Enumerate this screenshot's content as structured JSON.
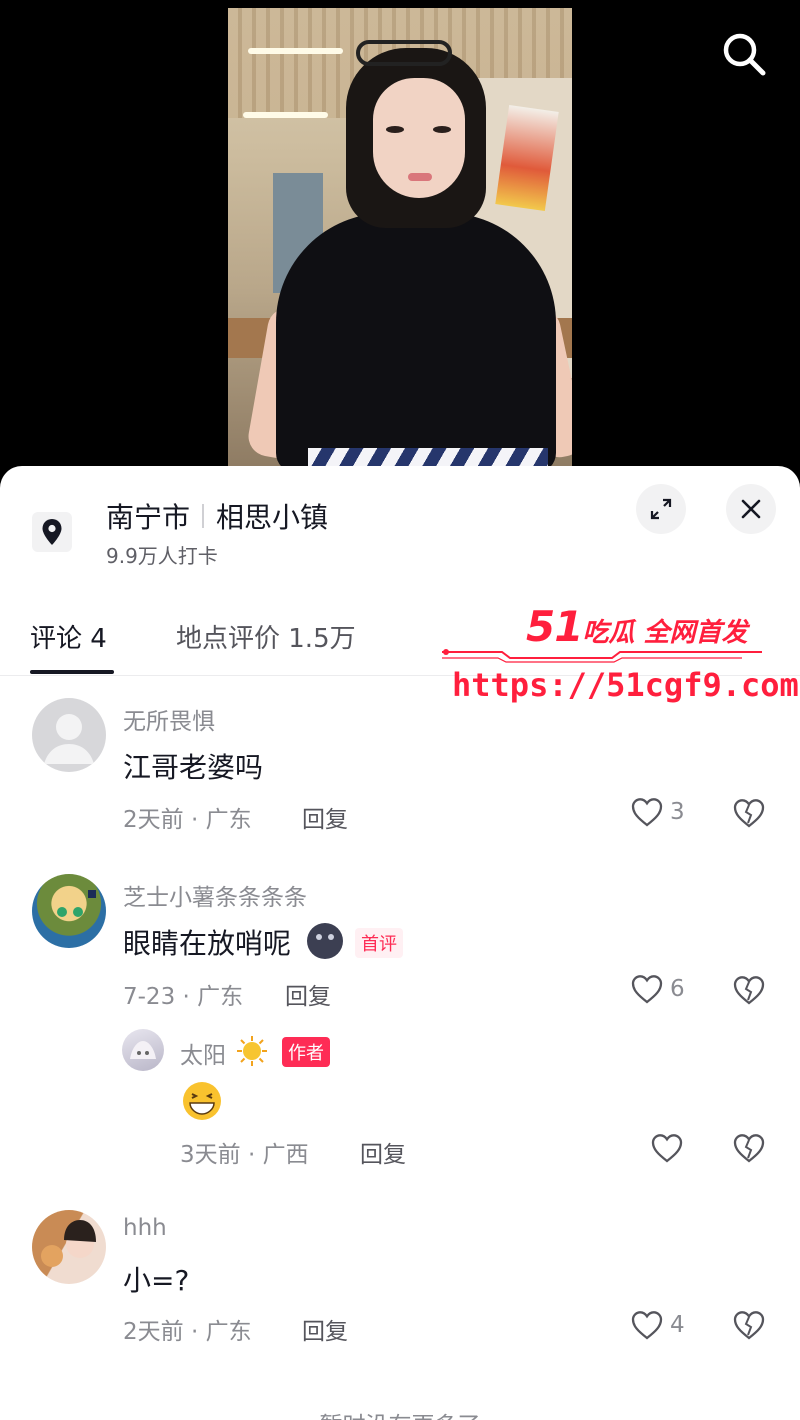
{
  "location": {
    "city": "南宁市",
    "place": "相思小镇",
    "checkins": "9.9万人打卡"
  },
  "tabs": [
    {
      "label": "评论 4",
      "active": true
    },
    {
      "label": "地点评价 1.5万",
      "active": false
    }
  ],
  "watermark": {
    "brand_num": "51",
    "brand_text": "吃瓜 全网首发",
    "url": "https://51cgf9.com"
  },
  "comments": [
    {
      "user": "无所畏惧",
      "text": "江哥老婆吗",
      "meta": "2天前 · 广东",
      "reply": "回复",
      "likes": "3"
    },
    {
      "user": "芝士小薯条条条条",
      "text": "眼睛在放哨呢",
      "badge": "首评",
      "meta": "7-23 · 广东",
      "reply": "回复",
      "likes": "6",
      "sub_reply": {
        "user": "太阳",
        "badge": "作者",
        "text": "😁",
        "meta": "3天前 · 广西",
        "reply": "回复"
      }
    },
    {
      "user": "hhh",
      "text": "小=?",
      "meta": "2天前 · 广东",
      "reply": "回复",
      "likes": "4"
    }
  ],
  "footer": "暂时没有更多了",
  "colors": {
    "accent": "#fe2c55",
    "watermark": "#ff1f3d"
  }
}
